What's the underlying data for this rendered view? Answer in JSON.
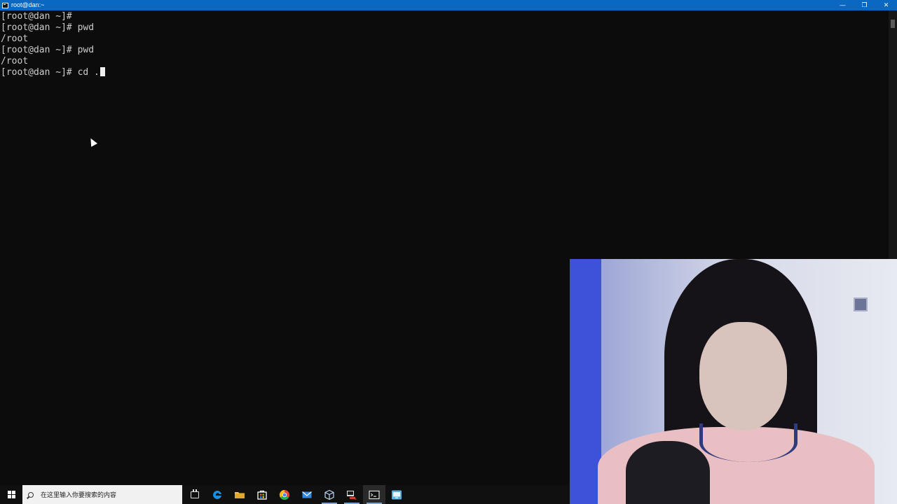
{
  "window": {
    "title": "root@dan:~",
    "controls": {
      "minimize": "—",
      "restore": "❐",
      "close": "✕"
    }
  },
  "terminal": {
    "lines": [
      "[root@dan ~]#",
      "[root@dan ~]# pwd",
      "/root",
      "[root@dan ~]# pwd",
      "/root"
    ],
    "current_input": "[root@dan ~]# cd ."
  },
  "taskbar": {
    "search_placeholder": "在这里输入你要搜索的内容",
    "apps": [
      {
        "name": "task-view",
        "icon": "task-view-icon",
        "color": "#ffffff"
      },
      {
        "name": "edge",
        "icon": "edge-icon",
        "color": "#1a8fe0"
      },
      {
        "name": "file-explorer",
        "icon": "folder-icon",
        "color": "#f2c94c"
      },
      {
        "name": "store",
        "icon": "store-icon",
        "color": "#ffffff"
      },
      {
        "name": "chrome",
        "icon": "chrome-icon",
        "color": "#e94235"
      },
      {
        "name": "mail",
        "icon": "mail-icon",
        "color": "#2f8ae0"
      },
      {
        "name": "virtualbox",
        "icon": "cube-icon",
        "color": "#7fb2e6"
      },
      {
        "name": "putty",
        "icon": "putty-icon",
        "color": "#d23b2f"
      },
      {
        "name": "terminal",
        "icon": "terminal-icon",
        "color": "#dddddd"
      },
      {
        "name": "remote",
        "icon": "remote-desktop-icon",
        "color": "#5bb0e0"
      }
    ]
  },
  "colors": {
    "titlebar": "#0a67c2",
    "terminal_bg": "#0c0c0c",
    "terminal_fg": "#cccccc",
    "taskbar": "#101010"
  }
}
